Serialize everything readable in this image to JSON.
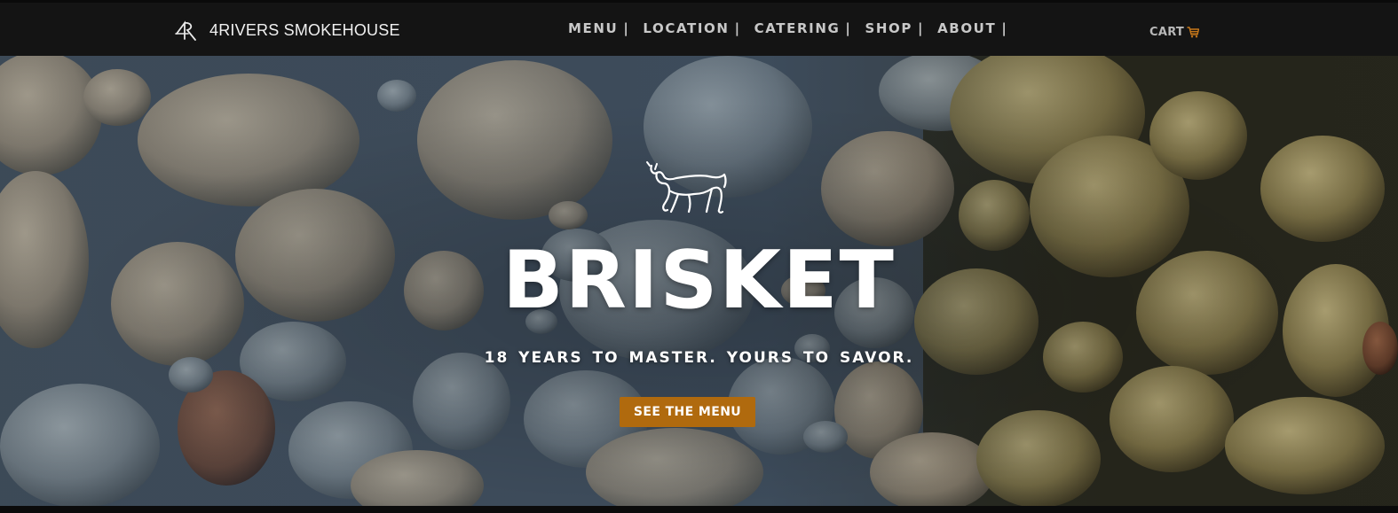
{
  "header": {
    "brand_name": "4RIVERS SMOKEHOUSE",
    "nav": [
      {
        "label": "MENU",
        "sep": "|"
      },
      {
        "label": "LOCATION",
        "sep": "|"
      },
      {
        "label": "CATERING",
        "sep": "|"
      },
      {
        "label": "SHOP",
        "sep": "|"
      },
      {
        "label": "ABOUT",
        "sep": "|"
      }
    ],
    "cart_label": "CART",
    "icons": {
      "logo": "4r-logo-icon",
      "cart": "shopping-cart-icon"
    }
  },
  "hero": {
    "icon": "bull-icon",
    "title": "BRISKET",
    "subtitle": "18 YEARS TO MASTER. YOURS TO SAVOR.",
    "cta_label": "SEE THE MENU"
  },
  "colors": {
    "nav_background": "#141414",
    "accent": "#b06a0e",
    "cart_icon": "#c8781a"
  }
}
